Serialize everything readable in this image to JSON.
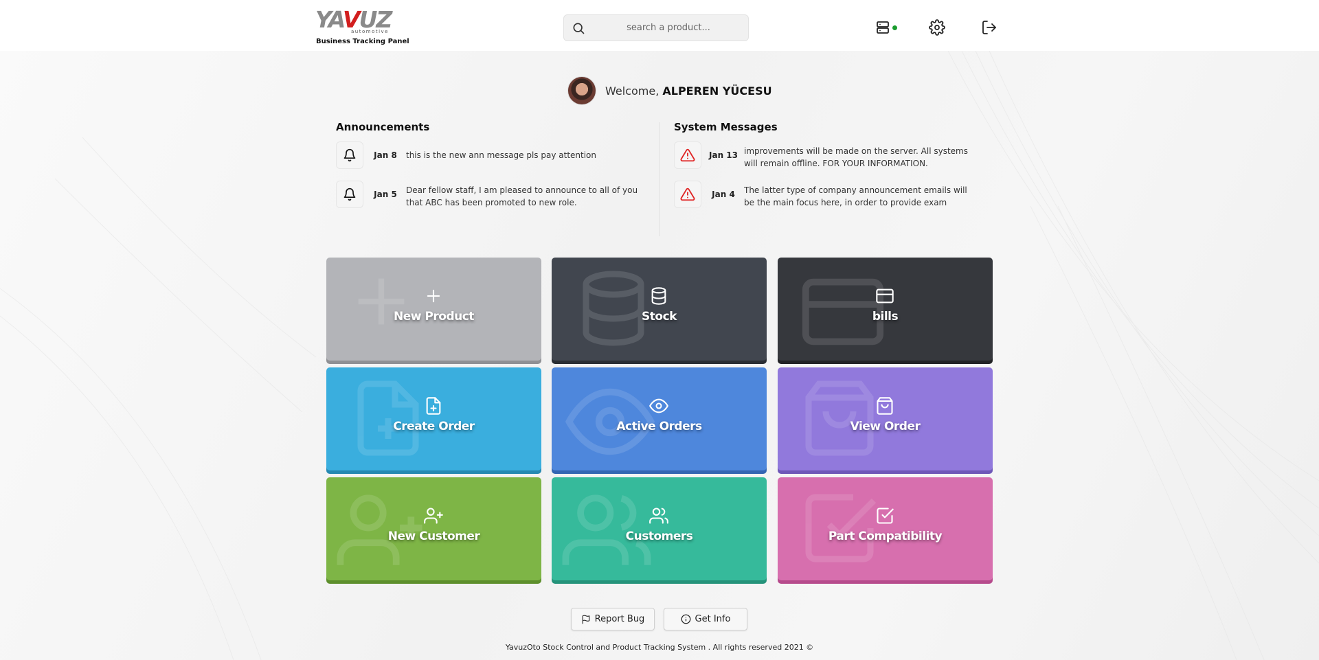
{
  "header": {
    "logo_text": "YAVUZ",
    "logo_sub": "automotive",
    "tagline": "Business Tracking Panel",
    "search_placeholder": "search a product...",
    "icons": [
      "server-status-icon",
      "gear-icon",
      "logout-icon"
    ],
    "server_status_color": "#1a9c2e"
  },
  "welcome": {
    "greeting": "Welcome,",
    "user_name": "ALPEREN YÜCESU"
  },
  "announcements": {
    "title": "Announcements",
    "items": [
      {
        "date": "Jan 8",
        "text": "this is the new ann message pls pay attention",
        "icon": "bell-icon"
      },
      {
        "date": "Jan 5",
        "text": "Dear fellow staff, I am pleased to announce to all of you that ABC has been promoted to new role.",
        "icon": "bell-icon"
      }
    ]
  },
  "system_messages": {
    "title": "System Messages",
    "items": [
      {
        "date": "Jan 13",
        "text": "improvements will be made on the server. All systems will remain offline. FOR YOUR INFORMATION.",
        "icon": "warning-icon"
      },
      {
        "date": "Jan 4",
        "text": "The latter type of company announcement emails will be the main focus here, in order to provide exam",
        "icon": "warning-icon"
      }
    ]
  },
  "tiles": [
    {
      "label": "New Product",
      "icon": "plus-icon",
      "color": "#b3b4b8",
      "shadow": "#8f9094"
    },
    {
      "label": "Stock",
      "icon": "database-icon",
      "color": "#41464f",
      "shadow": "#2a2e34"
    },
    {
      "label": "bills",
      "icon": "credit-card-icon",
      "color": "#36383d",
      "shadow": "#222326"
    },
    {
      "label": "Create Order",
      "icon": "file-plus-icon",
      "color": "#3aaede",
      "shadow": "#2689b2"
    },
    {
      "label": "Active Orders",
      "icon": "eye-icon",
      "color": "#4e87dc",
      "shadow": "#3466b3"
    },
    {
      "label": "View Order",
      "icon": "shopping-bag-icon",
      "color": "#9179dc",
      "shadow": "#6f58b8"
    },
    {
      "label": "New Customer",
      "icon": "user-plus-icon",
      "color": "#7eb546",
      "shadow": "#5d8f2c"
    },
    {
      "label": "Customers",
      "icon": "users-icon",
      "color": "#36ba9b",
      "shadow": "#25937a"
    },
    {
      "label": "Part Compatibility",
      "icon": "check-square-icon",
      "color": "#d76fae",
      "shadow": "#b64b8c"
    }
  ],
  "footer": {
    "report_bug": "Report Bug",
    "get_info": "Get Info",
    "copyright": "YavuzOto Stock Control and Product Tracking System . All rights reserved 2021 ©"
  }
}
